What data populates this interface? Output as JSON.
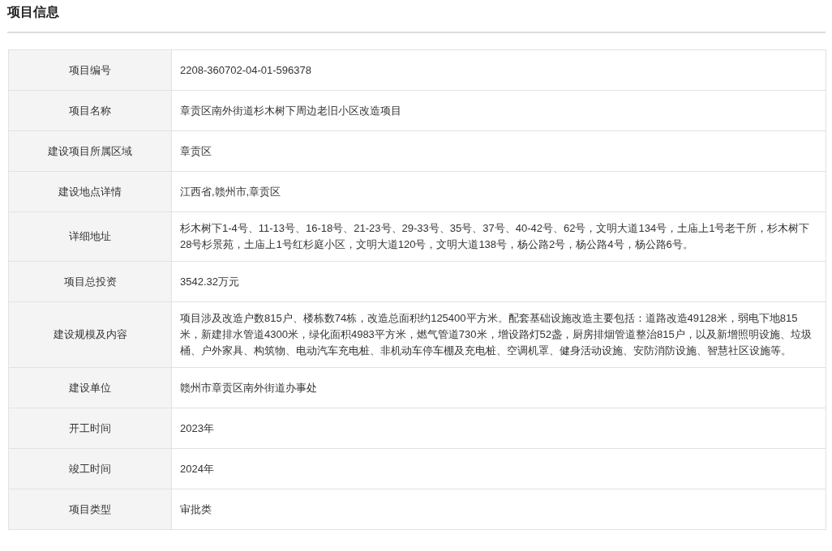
{
  "title": "项目信息",
  "table": {
    "rows": [
      {
        "label": "项目编号",
        "value": "2208-360702-04-01-596378"
      },
      {
        "label": "项目名称",
        "value": "章贡区南外街道杉木树下周边老旧小区改造项目"
      },
      {
        "label": "建设项目所属区域",
        "value": "章贡区"
      },
      {
        "label": "建设地点详情",
        "value": "江西省,赣州市,章贡区"
      },
      {
        "label": "详细地址",
        "value": "杉木树下1-4号、11-13号、16-18号、21-23号、29-33号、35号、37号、40-42号、62号，文明大道134号，土庙上1号老干所，杉木树下28号杉景苑，土庙上1号红杉庭小区，文明大道120号，文明大道138号，杨公路2号，杨公路4号，杨公路6号。"
      },
      {
        "label": "项目总投资",
        "value": "3542.32万元"
      },
      {
        "label": "建设规模及内容",
        "value": "项目涉及改造户数815户、楼栋数74栋，改造总面积约125400平方米。配套基础设施改造主要包括：道路改造49128米，弱电下地815米，新建排水管道4300米，绿化面积4983平方米，燃气管道730米，增设路灯52盏，厨房排烟管道整治815户，以及新增照明设施、垃圾桶、户外家具、构筑物、电动汽车充电桩、非机动车停车棚及充电桩、空调机罩、健身活动设施、安防消防设施、智慧社区设施等。"
      },
      {
        "label": "建设单位",
        "value": "赣州市章贡区南外街道办事处"
      },
      {
        "label": "开工时间",
        "value": "2023年"
      },
      {
        "label": "竣工时间",
        "value": "2024年"
      },
      {
        "label": "项目类型",
        "value": "审批类"
      }
    ]
  }
}
